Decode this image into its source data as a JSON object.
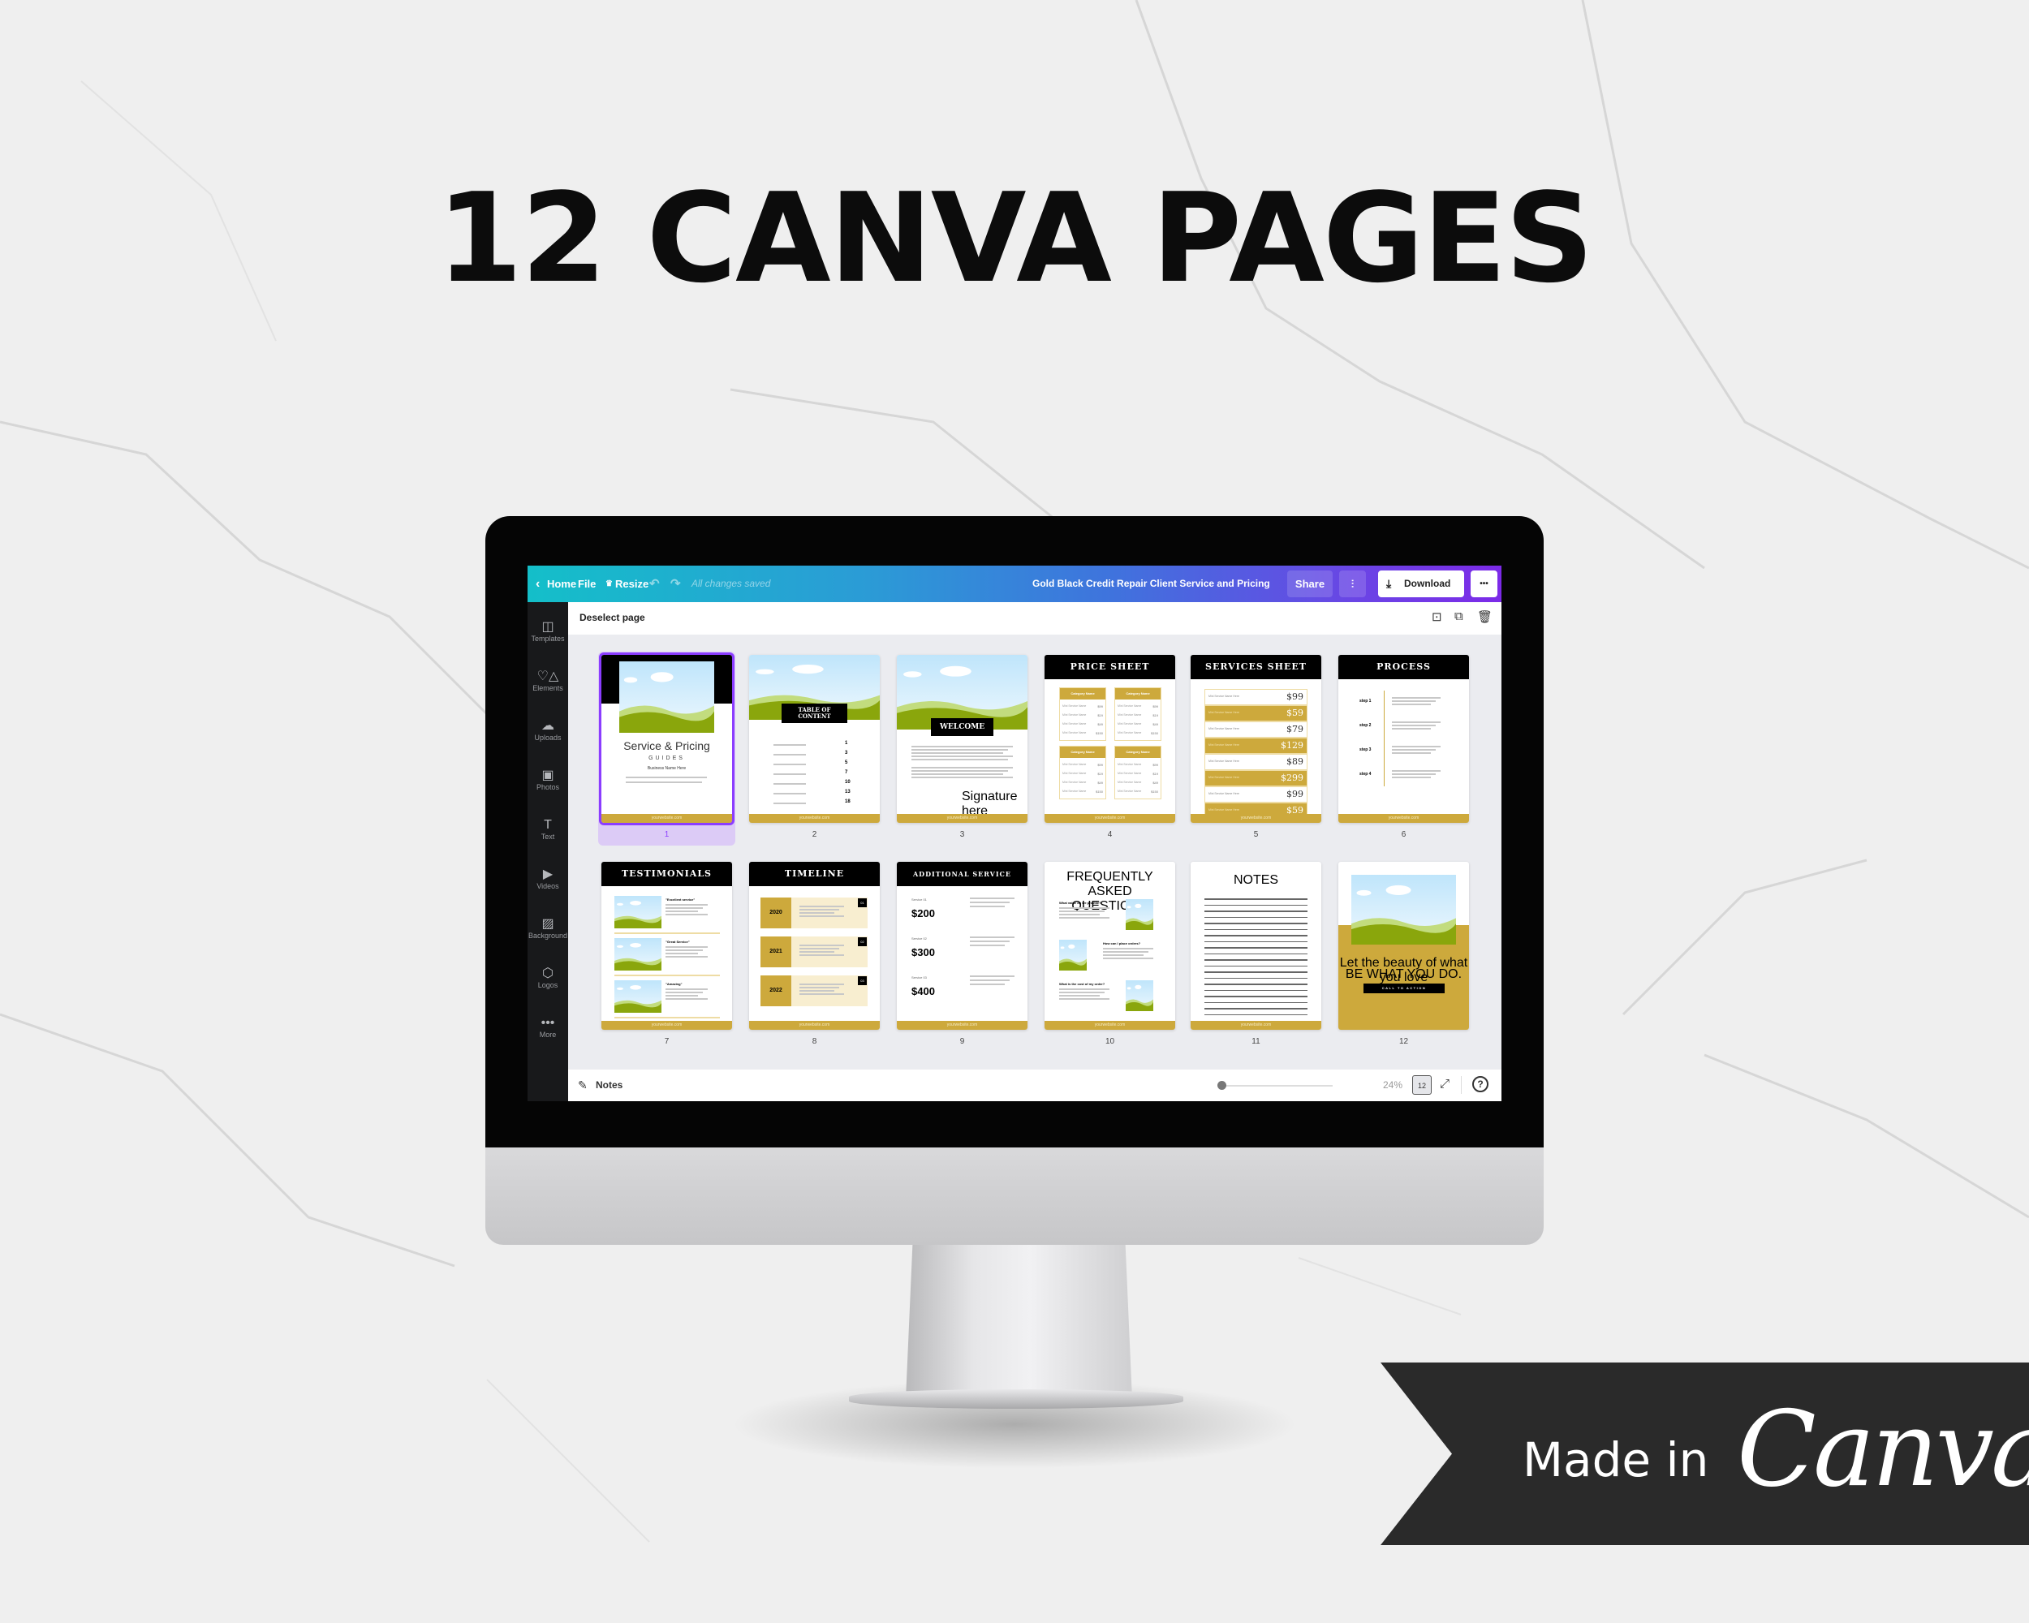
{
  "headline": "12 CANVA PAGES",
  "toolbar": {
    "home": "Home",
    "file": "File",
    "resize": "Resize",
    "status": "All changes saved",
    "doc_title": "Gold Black Credit Repair Client Service and Pricing",
    "share": "Share",
    "download": "Download",
    "more": "•••",
    "gradient": [
      "#14bfc9",
      "#7c2ae8"
    ]
  },
  "sidebar": [
    {
      "label": "Templates",
      "icon": "templates-icon",
      "glyph": "◫"
    },
    {
      "label": "Elements",
      "icon": "elements-icon",
      "glyph": "♡△"
    },
    {
      "label": "Uploads",
      "icon": "upload-cloud-icon",
      "glyph": "☁"
    },
    {
      "label": "Photos",
      "icon": "photo-icon",
      "glyph": "▣"
    },
    {
      "label": "Text",
      "icon": "text-icon",
      "glyph": "T"
    },
    {
      "label": "Videos",
      "icon": "video-icon",
      "glyph": "▶"
    },
    {
      "label": "Background",
      "icon": "background-icon",
      "glyph": "▨"
    },
    {
      "label": "Logos",
      "icon": "logo-icon",
      "glyph": "⬡"
    },
    {
      "label": "More",
      "icon": "more-icon",
      "glyph": "•••"
    }
  ],
  "header": {
    "deselect": "Deselect page"
  },
  "footer_text": "yourwebsite.com",
  "colors": {
    "gold": "#cda93c",
    "black": "#000000",
    "selection": "#8b3dff",
    "green": "#8aa60c"
  },
  "pages": [
    {
      "num": "1",
      "selected": true,
      "title": "Service & Pricing",
      "subtitle": "GUIDES",
      "business": "Business Name Here"
    },
    {
      "num": "2",
      "title": "TABLE OF CONTENT",
      "entries": [
        "1",
        "3",
        "5",
        "7",
        "10",
        "13",
        "18"
      ]
    },
    {
      "num": "3",
      "title": "WELCOME",
      "signature": "Signature here"
    },
    {
      "num": "4",
      "title": "PRICE SHEET",
      "category": "Category Name",
      "item": "Mini Service Name",
      "prices": [
        "$99",
        "$19",
        "$49",
        "$150"
      ]
    },
    {
      "num": "5",
      "title": "SERVICES SHEET",
      "item": "Mini Service Name Here",
      "prices": [
        "$99",
        "$59",
        "$79",
        "$129",
        "$89",
        "$299",
        "$99",
        "$59"
      ]
    },
    {
      "num": "6",
      "title": "PROCESS",
      "steps": [
        "step 1",
        "step 2",
        "step 3",
        "step 4"
      ]
    },
    {
      "num": "7",
      "title": "TESTIMONIALS",
      "quotes": [
        "\"Excellent service\"",
        "\"Great Service\"",
        "\"Amazing\""
      ]
    },
    {
      "num": "8",
      "title": "TIMELINE",
      "years": [
        "2020",
        "2021",
        "2022"
      ],
      "markers": [
        "01",
        "02",
        "03"
      ]
    },
    {
      "num": "9",
      "title": "ADDITIONAL SERVICE",
      "services": [
        {
          "label": "Service 01",
          "price": "$200"
        },
        {
          "label": "Service 02",
          "price": "$300"
        },
        {
          "label": "Service 03",
          "price": "$400"
        }
      ]
    },
    {
      "num": "10",
      "title": "FREQUENTLY ASKED QUESTIONS",
      "questions": [
        "What value do we provide?",
        "How can I place orders?",
        "What is the cost of my order?"
      ]
    },
    {
      "num": "11",
      "title": "NOTES"
    },
    {
      "num": "12",
      "script": "Let the beauty of what you love",
      "tagline": "BE WHAT YOU DO.",
      "cta": "CALL TO ACTION"
    }
  ],
  "bottombar": {
    "notes": "Notes",
    "zoom": "24%",
    "zoom_level": 0.0,
    "page_count": "12"
  },
  "banner": {
    "made_in": "Made in",
    "brand": "Canva"
  }
}
